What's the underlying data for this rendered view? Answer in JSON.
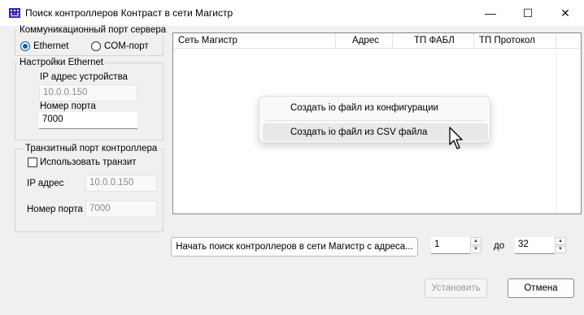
{
  "window": {
    "title": "Поиск контроллеров Контраст в сети Магистр",
    "buttons": {
      "minimize": "—",
      "maximize": "☐",
      "close": "✕"
    }
  },
  "server_port": {
    "group_label": "Коммуникационный порт сервера",
    "options": [
      {
        "label": "Ethernet",
        "selected": true
      },
      {
        "label": "COM-порт",
        "selected": false
      }
    ]
  },
  "ethernet": {
    "group_label": "Настройки Ethernet",
    "ip_label": "IP адрес устройства",
    "ip_value": "10.0.0.150",
    "port_label": "Номер порта",
    "port_value": "7000"
  },
  "transit": {
    "group_label": "Транзитный порт контроллера",
    "use_label": "Использовать транзит",
    "use_checked": false,
    "ip_label": "IP адрес",
    "ip_value": "10.0.0.150",
    "port_label": "Номер порта",
    "port_value": "7000"
  },
  "table": {
    "columns": [
      "Сеть Магистр",
      "Адрес",
      "ТП ФАБЛ",
      "ТП Протокол"
    ],
    "rows": []
  },
  "context_menu": {
    "items": [
      {
        "label": "Создать io файл из конфигурации",
        "hover": false
      },
      {
        "label": "Создать io файл из CSV файла",
        "hover": true
      }
    ]
  },
  "search": {
    "button_label": "Начать поиск контроллеров в сети Магистр с адреса...",
    "from_value": "1",
    "to_label": "до",
    "to_value": "32"
  },
  "footer": {
    "install_label": "Установить",
    "cancel_label": "Отмена"
  },
  "colors": {
    "accent": "#005fb8",
    "window_bg": "#f0f0f0"
  }
}
